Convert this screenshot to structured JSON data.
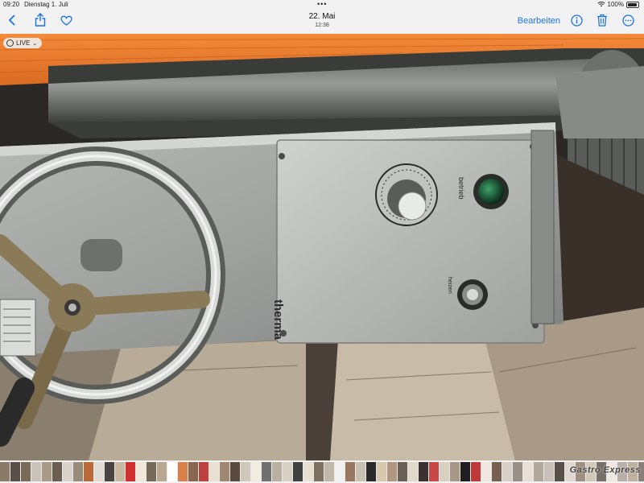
{
  "status": {
    "time": "09:20",
    "date": "Dienstag 1. Juli",
    "battery": "100%"
  },
  "nav": {
    "title": "22. Mai",
    "subtitle": "12:38",
    "edit_label": "Bearbeiten",
    "icons": [
      "chevron-left-icon",
      "share-icon",
      "heart-icon",
      "info-icon",
      "trash-icon",
      "more-icon"
    ],
    "accent": "#1a73e8"
  },
  "photo": {
    "live_label": "LIVE",
    "panel_brand": "therma",
    "label_betrieb": "betrieb",
    "label_heizen": "heizen"
  },
  "thumbnails": {
    "colors": [
      "#8a7a66",
      "#5a5048",
      "#7a6a58",
      "#c8c2b8",
      "#a89a86",
      "#6a5e50",
      "#d8d2c8",
      "#9a8c7a",
      "#b86a3a",
      "#e0dcd4",
      "#4a4440",
      "#c8b8a0",
      "#d03030",
      "#f0e8d8",
      "#786858",
      "#b8a890",
      "#ffffff",
      "#d8804a",
      "#886650",
      "#c04040",
      "#e8e0d0",
      "#a08870",
      "#5a4a40",
      "#cfc7b8",
      "#f2ece0",
      "#707070",
      "#b8b0a0",
      "#d8d0c0",
      "#404040",
      "#e8e0d0",
      "#807060",
      "#c0b8a8",
      "#f0f0f0",
      "#987860",
      "#c8c0b0",
      "#2a2a2a",
      "#d8c8b0",
      "#b09880",
      "#6a6058",
      "#e0d8c8",
      "#3a3230",
      "#c84848",
      "#d8d0c0",
      "#a89888",
      "#1e1e1e",
      "#c03838",
      "#f0e8e0",
      "#786050",
      "#d8d0c8",
      "#989088",
      "#e8e0d8",
      "#b0a898",
      "#c8c0b8",
      "#585048",
      "#e0d8d0",
      "#a09080",
      "#d0c8b8",
      "#787068",
      "#f0e8e0",
      "#b8b0a8",
      "#c0b0a0",
      "#888078"
    ],
    "watermark": "Gastro Express"
  }
}
